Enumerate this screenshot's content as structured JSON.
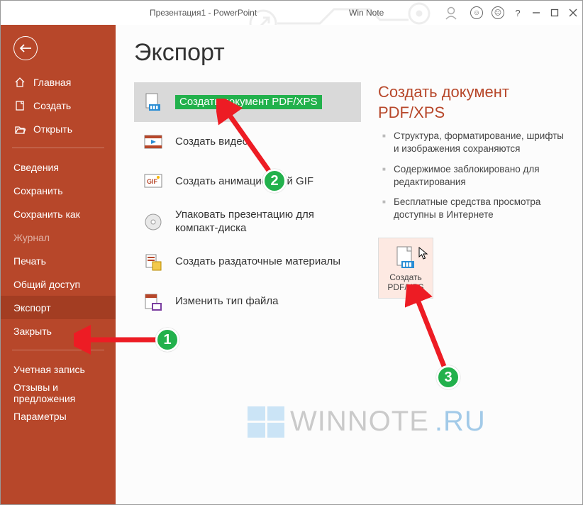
{
  "title": "Презентация1  -  PowerPoint",
  "win_note": "Win Note",
  "sidebar": {
    "items": [
      {
        "label": "Главная",
        "icon": "home"
      },
      {
        "label": "Создать",
        "icon": "new"
      },
      {
        "label": "Открыть",
        "icon": "open"
      }
    ],
    "items2": [
      {
        "label": "Сведения"
      },
      {
        "label": "Сохранить"
      },
      {
        "label": "Сохранить как"
      },
      {
        "label": "Журнал",
        "dim": true
      },
      {
        "label": "Печать"
      },
      {
        "label": "Общий доступ"
      },
      {
        "label": "Экспорт",
        "selected": true
      },
      {
        "label": "Закрыть"
      }
    ],
    "items3": [
      {
        "label": "Учетная запись"
      },
      {
        "label": "Отзывы и предложения"
      },
      {
        "label": "Параметры"
      }
    ]
  },
  "page": {
    "heading": "Экспорт",
    "list": [
      {
        "label": "Создать документ PDF/XPS",
        "selected": true,
        "icon": "pdf"
      },
      {
        "label": "Создать видео",
        "icon": "video"
      },
      {
        "label": "Создать анимационный GIF",
        "icon": "gif"
      },
      {
        "label": "Упаковать презентацию для компакт-диска",
        "icon": "cd"
      },
      {
        "label": "Создать раздаточные материалы",
        "icon": "handout"
      },
      {
        "label": "Изменить тип файла",
        "icon": "change"
      }
    ],
    "panel_title": "Создать документ PDF/XPS",
    "bullets": [
      "Структура, форматирование, шрифты и изображения сохраняются",
      "Содержимое заблокировано для редактирования",
      "Бесплатные средства просмотра доступны в Интернете"
    ],
    "button_label": "Создать PDF/XPS"
  },
  "annotations": {
    "a1": "1",
    "a2": "2",
    "a3": "3"
  },
  "watermark": {
    "grey": "WINNOTE",
    "blue": ".RU"
  }
}
